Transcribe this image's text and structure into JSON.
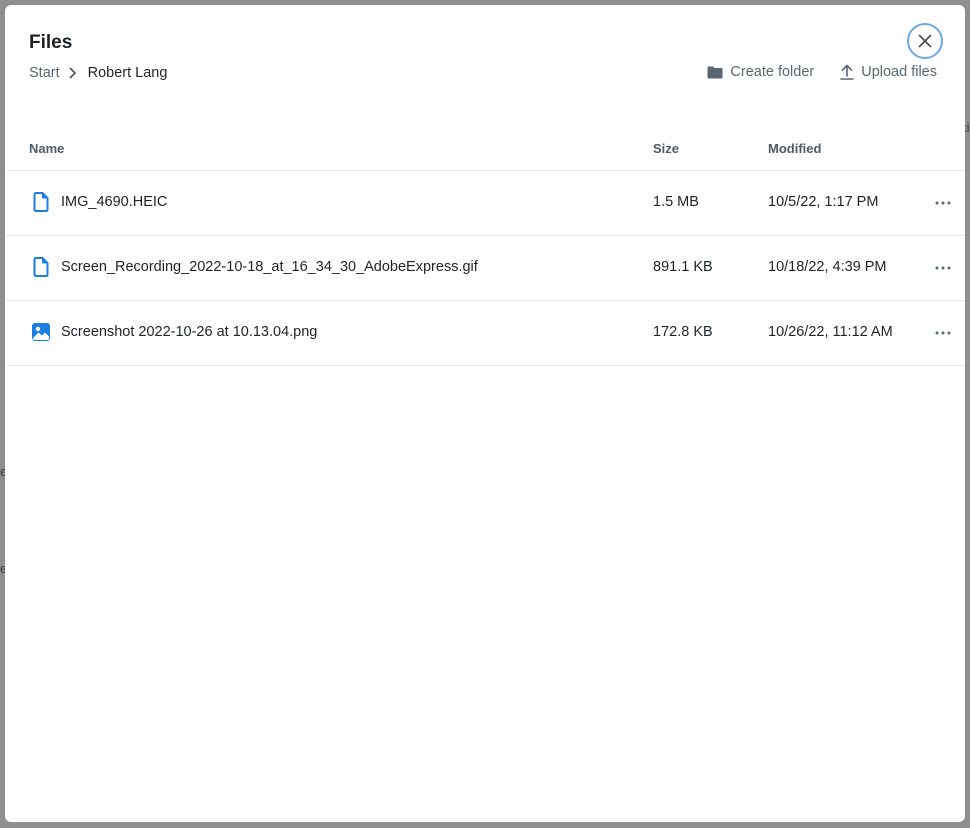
{
  "modal": {
    "title": "Files",
    "breadcrumb": {
      "root": "Start",
      "current": "Robert Lang"
    },
    "actions": {
      "create_folder": "Create folder",
      "upload_files": "Upload files"
    }
  },
  "table": {
    "columns": {
      "name": "Name",
      "size": "Size",
      "modified": "Modified"
    },
    "rows": [
      {
        "name": "IMG_4690.HEIC",
        "size": "1.5 MB",
        "modified": "10/5/22, 1:17 PM",
        "icon": "document-icon"
      },
      {
        "name": "Screen_Recording_2022-10-18_at_16_34_30_AdobeExpress.gif",
        "size": "891.1 KB",
        "modified": "10/18/22, 4:39 PM",
        "icon": "document-icon"
      },
      {
        "name": "Screenshot 2022-10-26 at 10.13.04.png",
        "size": "172.8 KB",
        "modified": "10/26/22, 11:12 AM",
        "icon": "image-icon"
      }
    ]
  },
  "colors": {
    "accent": "#1c7ee0",
    "muted_text": "#5a6673",
    "close_ring": "#6aa9e6"
  }
}
